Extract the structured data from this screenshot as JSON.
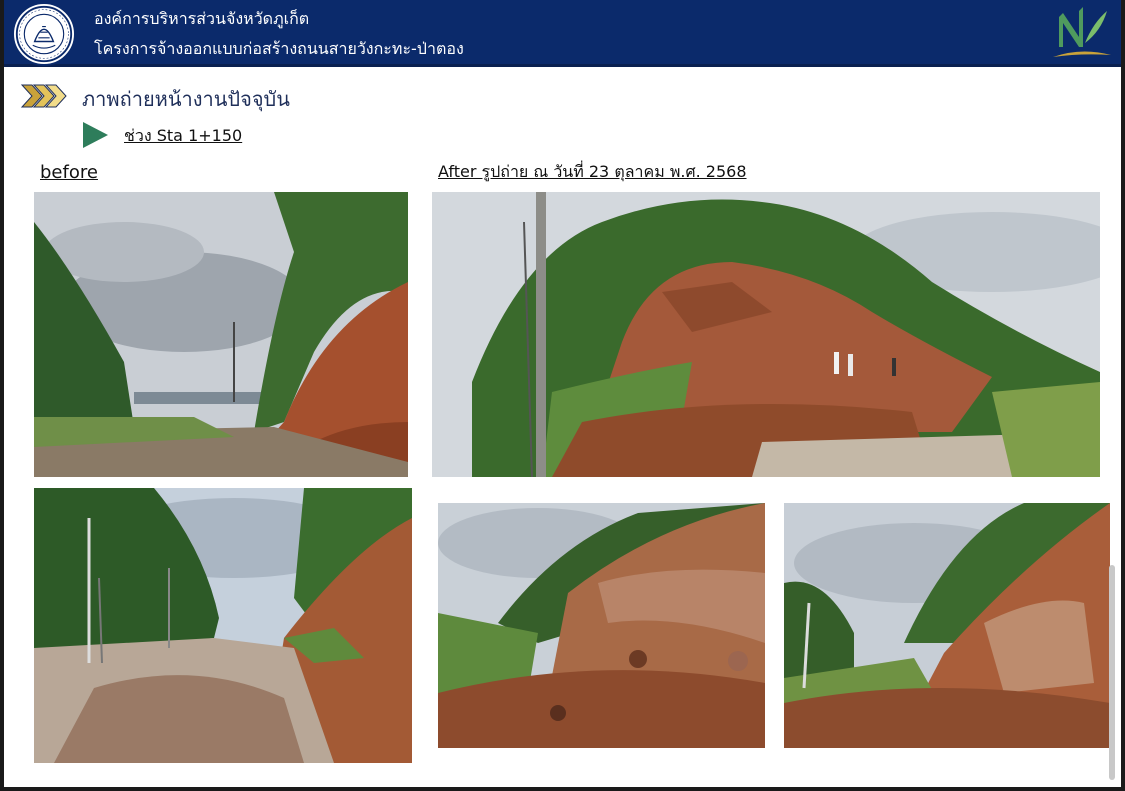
{
  "header": {
    "org_name": "องค์การบริหารส่วนจังหวัดภูเก็ต",
    "project_name": "โครงการจ้างออกแบบก่อสร้างถนนสายวังกะทะ-ป่าตอง",
    "seal_icon": "provincial-seal-icon",
    "brand_icon": "n-leaf-logo-icon",
    "colors": {
      "header_bg": "#0b2a6b",
      "accent_gold": "#c9a23a",
      "play_green": "#2e7d5b"
    }
  },
  "section": {
    "title": "ภาพถ่ายหน้างานปัจจุบัน",
    "title_icon": "triple-chevron-icon",
    "station_label": "ช่วง Sta 1+150",
    "station_icon": "play-triangle-icon"
  },
  "labels": {
    "before": "before",
    "after": "After    รูปถ่าย ณ วันที่ 23 ตุลาคม พ.ศ. 2568"
  }
}
